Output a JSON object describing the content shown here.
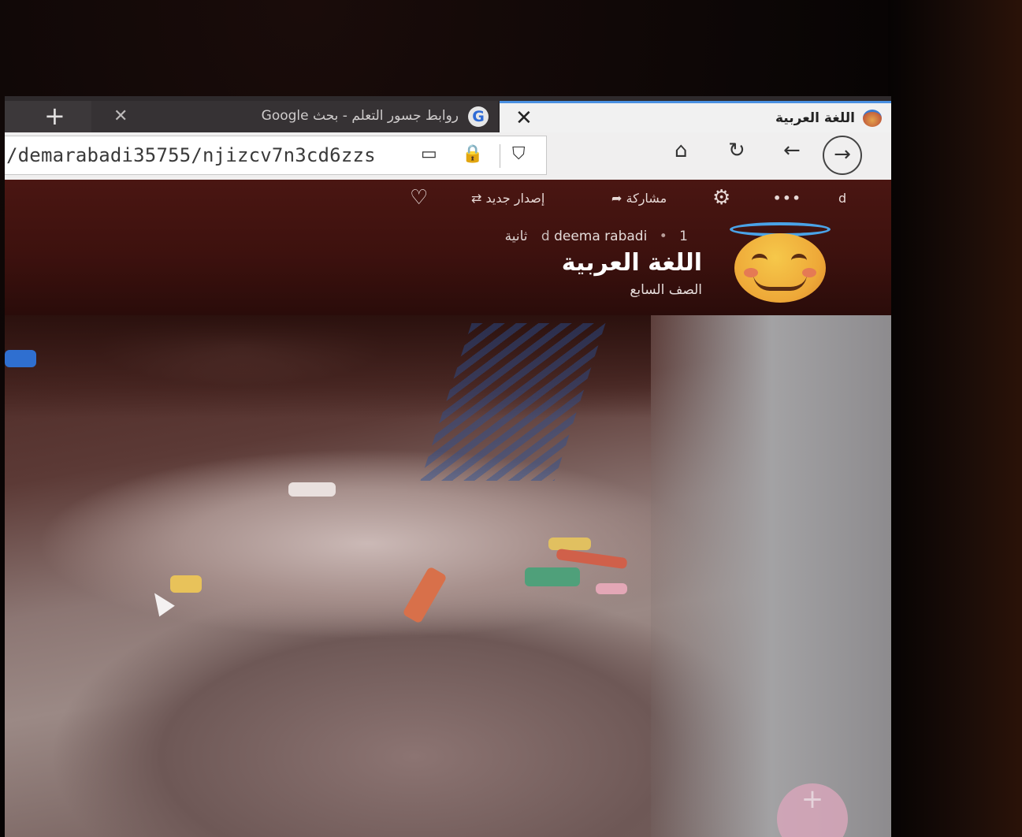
{
  "browser": {
    "tabs": [
      {
        "title": "اللغة العربية",
        "active": true
      },
      {
        "title": "روابط جسور التعلم - بحث Google",
        "active": false
      }
    ],
    "new_tab_glyph": "+",
    "close_glyph": "✕",
    "url": "/demarabadi35755/njizcv7n3cd6zzs"
  },
  "toolbar_actions": {
    "more": "•••",
    "share": "مشاركة",
    "remake": "إصدار جديد",
    "d": "d"
  },
  "header": {
    "author_initial": "d",
    "author": "deema rabadi",
    "time": "1 ثانية",
    "title": "اللغة العربية",
    "subtitle": "الصف السابع"
  },
  "icons": {
    "tab_favicon": "halo-smiley-icon",
    "google_tab": "google-icon",
    "avatar": "smiling-face-with-halo-icon",
    "fab": "plus-icon"
  },
  "colors": {
    "header_bg": "#3d110e",
    "tab_accent": "#4a90e2",
    "fab": "#d7a6ba"
  }
}
